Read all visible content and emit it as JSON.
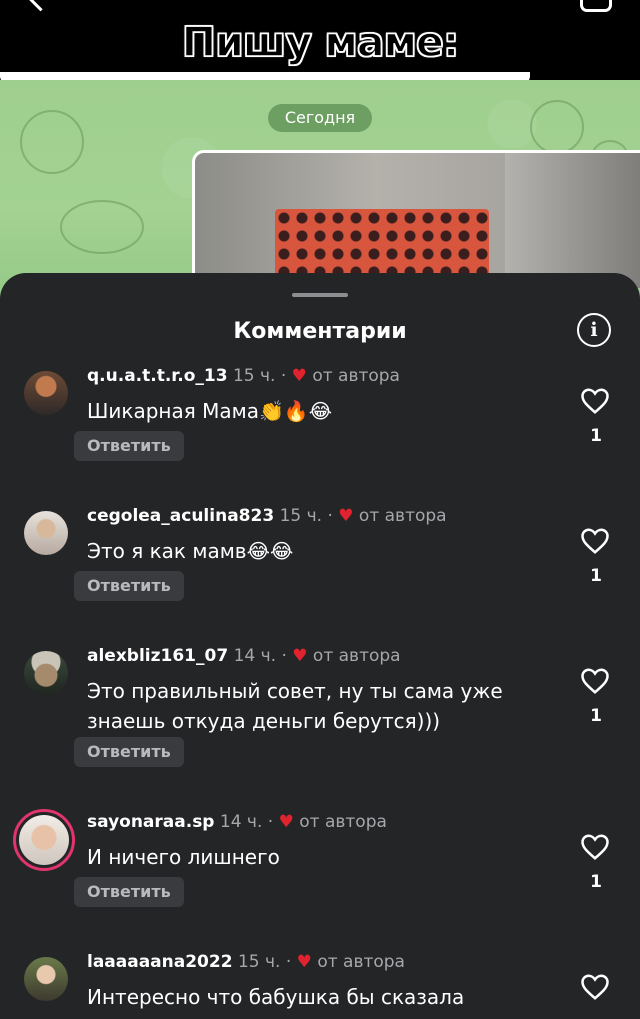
{
  "caption": "Пишу маме:",
  "chat": {
    "date_label": "Сегодня"
  },
  "sheet": {
    "title": "Комментарии",
    "info_icon": "i"
  },
  "reply_label": "Ответить",
  "author_label": "от автора",
  "colors": {
    "sheet_bg": "#242527",
    "heart": "#e0232e",
    "reply_bg": "#3a3b3e",
    "chat_green": "#a3d293"
  },
  "comments": [
    {
      "username": "q.u.a.t.t.r.o_13",
      "time": "15 ч. ·",
      "text": "Шикарная Мама👏🔥😂",
      "likes": "1",
      "avatar_icon": "avatar-icon"
    },
    {
      "username": "cegolea_aculina823",
      "time": "15 ч. ·",
      "text": "Это я как мамв😂😂",
      "likes": "1",
      "avatar_icon": "avatar-icon"
    },
    {
      "username": "alexbliz161_07",
      "time": "14 ч. ·",
      "text": "Это правильный совет, ну ты сама уже знаешь откуда деньги берутся)))",
      "likes": "1",
      "avatar_icon": "avatar-icon"
    },
    {
      "username": "sayonaraa.sp",
      "time": "14 ч. ·",
      "text": "И ничего лишнего",
      "likes": "1",
      "avatar_icon": "avatar-story-icon"
    },
    {
      "username": "laaaaaana2022",
      "time": "15 ч. ·",
      "text": "Интересно что бабушка бы сказала",
      "likes": "",
      "avatar_icon": "avatar-icon"
    }
  ]
}
